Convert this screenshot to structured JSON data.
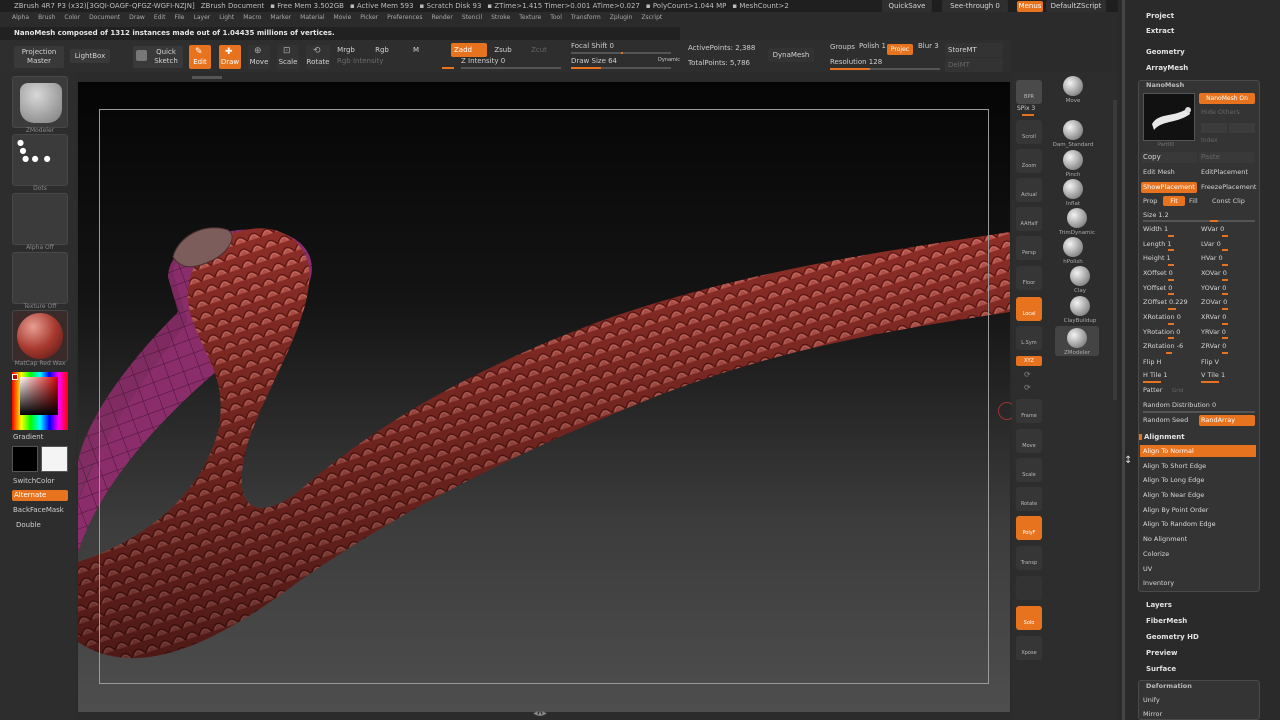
{
  "title_bar": {
    "items": [
      "ZBrush 4R7 P3 (x32)[3GQI-OAGF-QFGZ-WGFI-NZJN]",
      "ZBrush Document",
      "▪ Free Mem 3.502GB",
      "▪ Active Mem 593",
      "▪ Scratch Disk 93",
      "▪ ZTime>1.415 Timer>0.001 ATime>0.027",
      "▪ PolyCount>1.044 MP",
      "▪ MeshCount>2"
    ],
    "quicksave": "QuickSave",
    "see_through": "See-through  0",
    "menus": "Menus",
    "script": "DefaultZScript"
  },
  "menu_bar": [
    "Alpha",
    "Brush",
    "Color",
    "Document",
    "Draw",
    "Edit",
    "File",
    "Layer",
    "Light",
    "Macro",
    "Marker",
    "Material",
    "Movie",
    "Picker",
    "Preferences",
    "Render",
    "Stencil",
    "Stroke",
    "Texture",
    "Tool",
    "Transform",
    "Zplugin",
    "Zscript"
  ],
  "note": "NanoMesh composed of 1312 instances made out of 1.04435 millions of vertices.",
  "toolbar": {
    "projection_master": "Projection Master",
    "lightbox": "LightBox",
    "quick_sketch": "Quick Sketch",
    "edit": "Edit",
    "draw": "Draw",
    "move": "Move",
    "scale": "Scale",
    "rotate": "Rotate",
    "mrgb": "Mrgb",
    "rgb": "Rgb",
    "m": "M",
    "rgb_intensity": "Rgb Intensity",
    "zadd": "Zadd",
    "zsub": "Zsub",
    "zcut": "Zcut",
    "z_intensity": "Z Intensity 0",
    "focal_shift": "Focal Shift 0",
    "draw_size": "Draw Size 64",
    "dynamic": "Dynamic",
    "active_points": "ActivePoints: 2,388",
    "total_points": "TotalPoints: 5,786",
    "dynamesh": "DynaMesh",
    "groups": "Groups",
    "polish": "Polish 1",
    "projec": "Projec",
    "blur": "Blur 3",
    "resolution": "Resolution 128",
    "storemt": "StoreMT",
    "delmt": "DelMT"
  },
  "left_tray": {
    "zmodeler": "ZModeler",
    "dots": "Dots",
    "alpha_off": "Alpha Off",
    "texture_off": "Texture Off",
    "matcap": "MatCap Red Wax",
    "gradient": "Gradient",
    "switch_color": "SwitchColor",
    "alternate": "Alternate",
    "backface_mask": "BackFaceMask",
    "double": "Double"
  },
  "right_tools": {
    "bpr": "BPR",
    "spix": "SPix 3",
    "scroll": "Scroll",
    "zoom": "Zoom",
    "actual": "Actual",
    "aahalf": "AAHalf",
    "persp": "Persp",
    "floor": "Floor",
    "local": "Local",
    "lsym": "L.Sym",
    "xyz": "XYZ",
    "frame": "Frame",
    "move": "Move",
    "scale": "Scale",
    "rotate": "Rotate",
    "polyf": "PolyF",
    "transp": "Transp",
    "solo": "Solo",
    "xpose": "Xpose"
  },
  "brushes": [
    "Move",
    "Dam_Standard",
    "Pinch",
    "Inflat",
    "TrimDynamic",
    "hPolish",
    "Clay",
    "ClayBuildup",
    "ZModeler"
  ],
  "panel": {
    "project": "Project",
    "extract": "Extract",
    "geometry": "Geometry",
    "arraymesh": "ArrayMesh",
    "nanomesh": "NanoMesh",
    "nanomesh_on": "NanoMesh On",
    "hide_others": "Hide Others",
    "index": "Index",
    "part": "Part00",
    "copy": "Copy",
    "paste": "Paste",
    "edit_mesh": "Edit Mesh",
    "edit_placement": "EditPlacement",
    "show_placement": "ShowPlacement",
    "freeze_placement": "FreezePlacement",
    "prop": "Prop",
    "fit": "Fit",
    "fill": "Fill",
    "const_clip": "Const Clip",
    "size": "Size 1.2",
    "width": "Width 1",
    "wvar": "WVar 0",
    "length": "Length 1",
    "lvar": "LVar 0",
    "height": "Height 1",
    "hvar": "HVar 0",
    "xoffset": "XOffset 0",
    "xovar": "XOVar 0",
    "yoffset": "YOffset 0",
    "yovar": "YOVar 0",
    "zoffset": "ZOffset 0.229",
    "zovar": "ZOVar 0",
    "xrotation": "XRotation 0",
    "xrvar": "XRVar 0",
    "yrotation": "YRotation 0",
    "yrvar": "YRVar 0",
    "zrotation": "ZRotation -6",
    "zrvar": "ZRVar 0",
    "flip_h": "Flip H",
    "flip_v": "Flip V",
    "h_tile": "H Tile 1",
    "v_tile": "V Tile 1",
    "pattern": "Patter",
    "grid": "Grid",
    "random_distribution": "Random Distribution 0",
    "random_seed": "Random Seed",
    "randarray": "RandArray",
    "alignment": "Alignment",
    "align_items": [
      "Align To Normal",
      "Align To Short Edge",
      "Align To Long Edge",
      "Align To Near Edge",
      "Align By Point Order",
      "Align To Random Edge",
      "No Alignment"
    ],
    "colorize": "Colorize",
    "uv": "UV",
    "inventory": "Inventory",
    "layers": "Layers",
    "fibermesh": "FiberMesh",
    "geometry_hd": "Geometry HD",
    "preview": "Preview",
    "surface": "Surface",
    "deformation": "Deformation",
    "unify": "Unify",
    "mirror": "Mirror"
  }
}
